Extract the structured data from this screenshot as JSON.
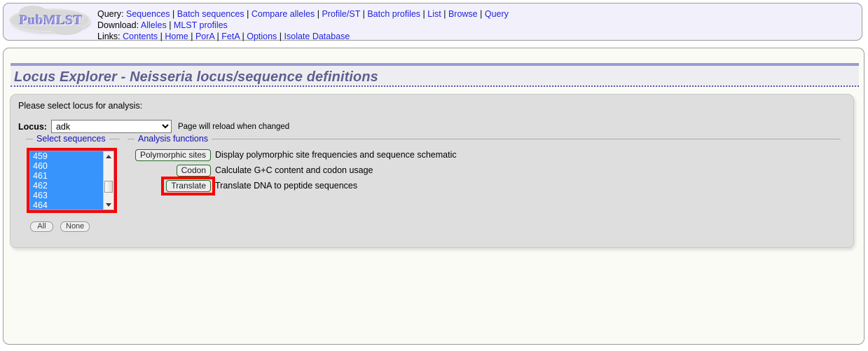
{
  "header": {
    "logo_text": "PubMLST",
    "rows": [
      {
        "label": "Query:",
        "links": [
          "Sequences",
          "Batch sequences",
          "Compare alleles",
          "Profile/ST",
          "Batch profiles",
          "List",
          "Browse",
          "Query"
        ]
      },
      {
        "label": "Download:",
        "links": [
          "Alleles",
          "MLST profiles"
        ]
      },
      {
        "label": "Links:",
        "links": [
          "Contents",
          "Home",
          "PorA",
          "FetA",
          "Options",
          "Isolate Database"
        ]
      }
    ],
    "separator": "|"
  },
  "page": {
    "title": "Locus Explorer - Neisseria locus/sequence definitions"
  },
  "options": {
    "prompt": "Please select locus for analysis:",
    "locus_label": "Locus:",
    "locus_value": "adk",
    "locus_options": [
      "adk"
    ],
    "reload_note": "Page will reload when changed"
  },
  "select_sequences": {
    "legend": "Select sequences",
    "items": [
      "459",
      "460",
      "461",
      "462",
      "463",
      "464"
    ],
    "selected": [
      "459",
      "460",
      "461",
      "462",
      "463",
      "464"
    ],
    "all_button": "All",
    "none_button": "None",
    "scrollbar": {
      "up_icon": "triangle-up-icon",
      "down_icon": "triangle-down-icon"
    }
  },
  "analysis": {
    "legend": "Analysis functions",
    "rows": [
      {
        "button": "Polymorphic sites",
        "description": "Display polymorphic site frequencies and sequence schematic",
        "highlighted": false
      },
      {
        "button": "Codon",
        "description": "Calculate G+C content and codon usage",
        "highlighted": false
      },
      {
        "button": "Translate",
        "description": "Translate DNA to peptide sequences",
        "highlighted": true
      }
    ]
  },
  "colors": {
    "highlight_red": "#fb0000",
    "selection_blue": "#3894fd",
    "link_blue": "#2222dd",
    "legend_blue": "#1111bb",
    "title_slate": "#5f5f8f",
    "panel_gray": "#dedede",
    "header_lavender": "#f2f1fb",
    "button_green_border": "#2a6b2a"
  }
}
